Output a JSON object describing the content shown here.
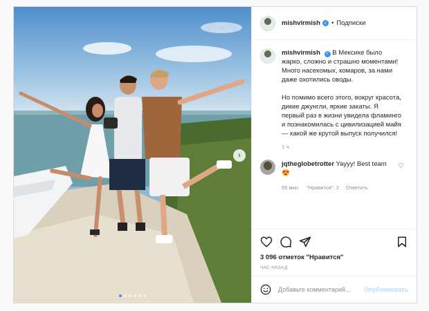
{
  "post": {
    "username": "mishvirmish",
    "separator": "•",
    "follow_label": "Подписки",
    "caption_paragraph_1": "В Мексике было жарко, сложно и страшно моментами! Много насекомых, комаров, за нами даже охотились оводы.",
    "caption_paragraph_2": "Но помимо всего этого, вокруг красота, дикие джунгли, яркие закаты. Я первый раз в жизни увидела фламинго и познакомилась с цивилизацией майя — какой же крутой выпуск получился!",
    "caption_time": "1 ч.",
    "comment": {
      "username": "jqtheglobetrotter",
      "text": "Yayyy! Best team",
      "emoji": "😍",
      "time": "55 мин.",
      "likes": "\"Нравится\": 2",
      "reply_label": "Ответить"
    },
    "likes_count": "3 096 отметок \"Нравится\"",
    "posted_ago": "ЧАС НАЗАД",
    "comment_placeholder": "Добавьте комментарий...",
    "publish_label": "Опубликовать",
    "carousel": {
      "total": 6,
      "active": 1
    },
    "icons": [
      "heart-icon",
      "comment-icon",
      "share-icon",
      "bookmark-icon",
      "smile-icon",
      "chevron-right-icon",
      "verified-icon"
    ],
    "colors": {
      "accent": "#3897f0",
      "publish_disabled": "#b2dffc",
      "muted": "#8e8e8e"
    }
  }
}
